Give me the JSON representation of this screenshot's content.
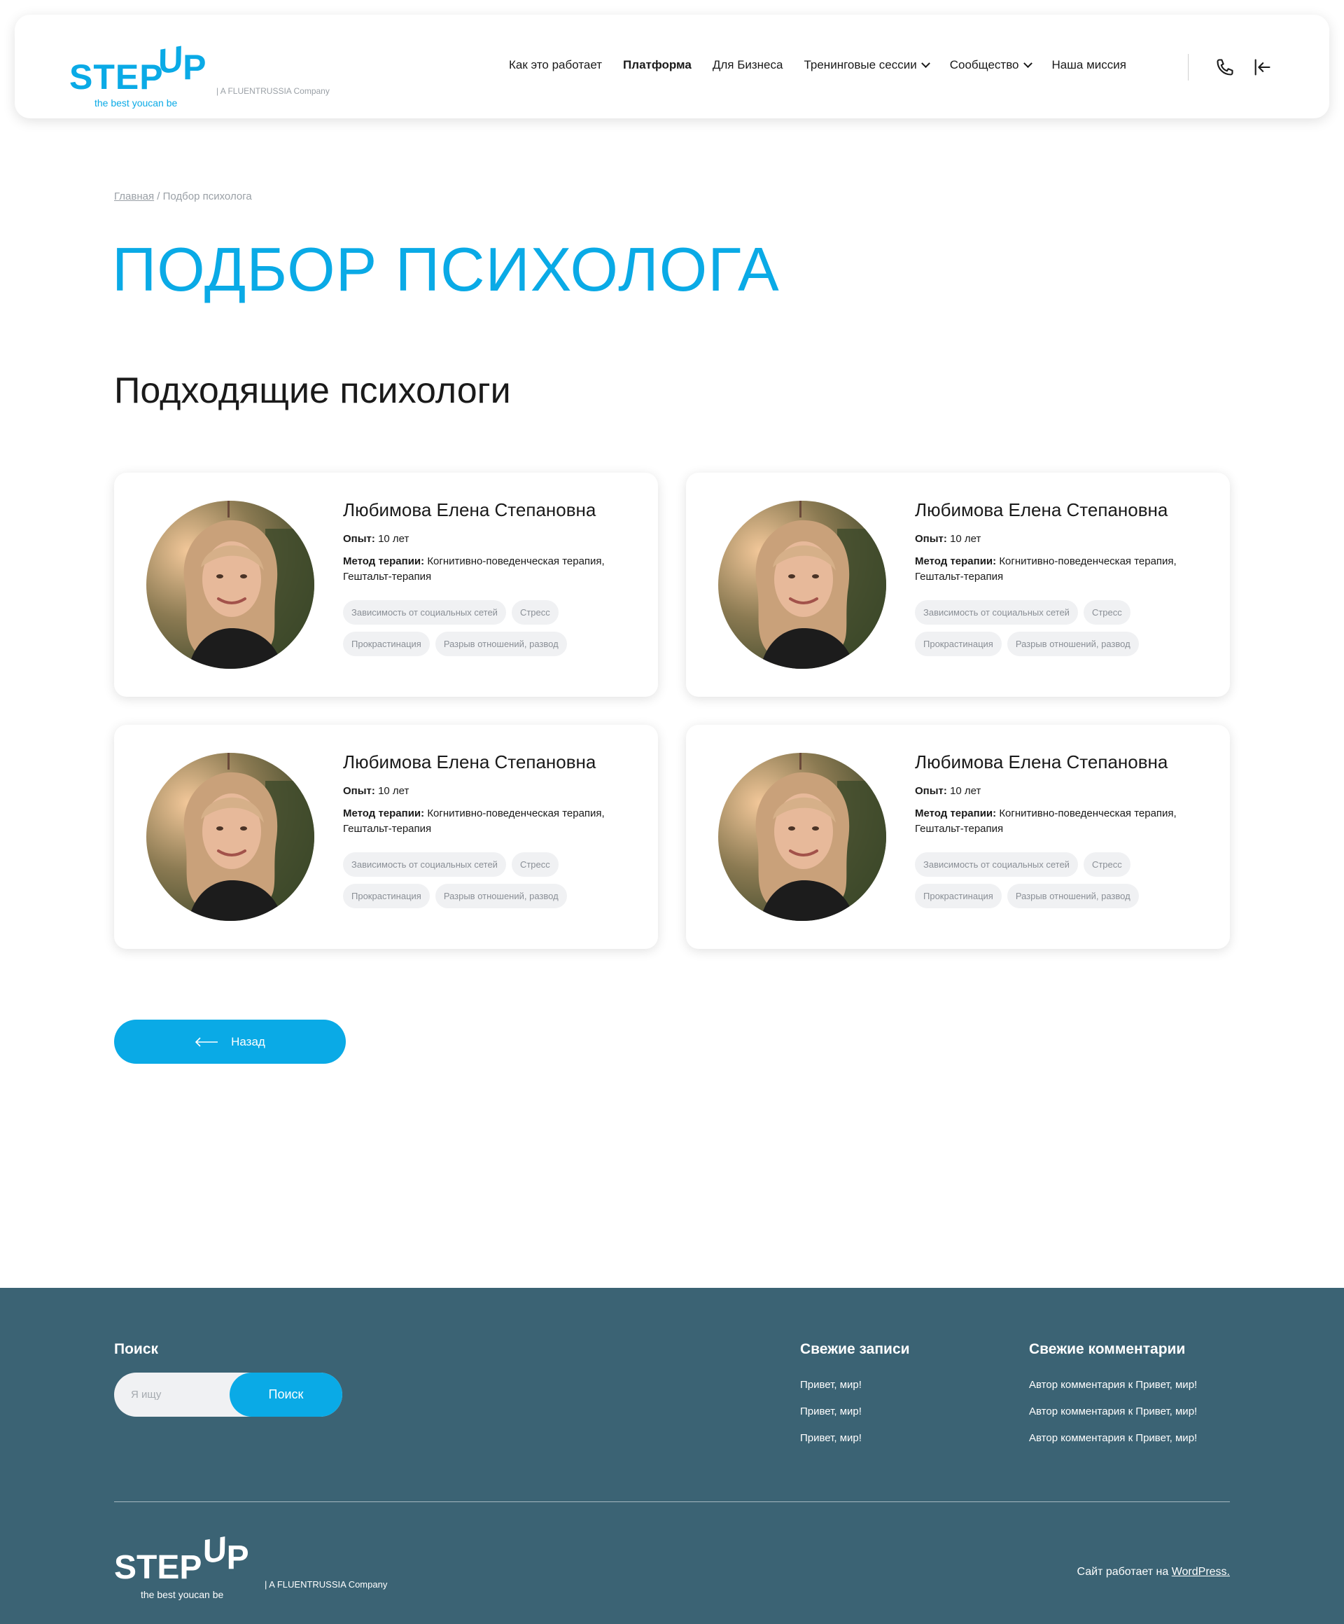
{
  "brand": {
    "step": "STEP",
    "up": "UP",
    "tagline": "the best youcan be",
    "company": "| A FLUENTRUSSIA Company",
    "accent_color": "#0aaae6",
    "footer_color": "#3b6374"
  },
  "nav": {
    "items": [
      {
        "label": "Как это работает",
        "dropdown": false
      },
      {
        "label": "Платформа",
        "dropdown": false
      },
      {
        "label": "Для Бизнеса",
        "dropdown": false
      },
      {
        "label": "Тренинговые сессии",
        "dropdown": true
      },
      {
        "label": "Сообщество",
        "dropdown": true
      },
      {
        "label": "Наша миссия",
        "dropdown": false
      }
    ],
    "icons": [
      "phone-icon",
      "login-icon"
    ]
  },
  "breadcrumb": {
    "home": "Главная",
    "separator": "/",
    "current": "Подбор психолога"
  },
  "page": {
    "title": "ПОДБОР ПСИХОЛОГА",
    "section_title": "Подходящие психологи",
    "back_label": "Назад"
  },
  "cards": [
    {
      "name": "Любимова Елена Степановна",
      "exp_label": "Опыт:",
      "exp_value": "10 лет",
      "method_label": "Метод терапии:",
      "method_value": "Когнитивно-поведенческая терапия, Гештальт-терапия",
      "tags": [
        "Зависимость от социальных сетей",
        "Стресс",
        "Прокрастинация",
        "Разрыв отношений, развод"
      ]
    },
    {
      "name": "Любимова Елена Степановна",
      "exp_label": "Опыт:",
      "exp_value": "10 лет",
      "method_label": "Метод терапии:",
      "method_value": "Когнитивно-поведенческая терапия, Гештальт-терапия",
      "tags": [
        "Зависимость от социальных сетей",
        "Стресс",
        "Прокрастинация",
        "Разрыв отношений, развод"
      ]
    },
    {
      "name": "Любимова Елена Степановна",
      "exp_label": "Опыт:",
      "exp_value": "10 лет",
      "method_label": "Метод терапии:",
      "method_value": "Когнитивно-поведенческая терапия, Гештальт-терапия",
      "tags": [
        "Зависимость от социальных сетей",
        "Стресс",
        "Прокрастинация",
        "Разрыв отношений, развод"
      ]
    },
    {
      "name": "Любимова Елена Степановна",
      "exp_label": "Опыт:",
      "exp_value": "10 лет",
      "method_label": "Метод терапии:",
      "method_value": "Когнитивно-поведенческая терапия, Гештальт-терапия",
      "tags": [
        "Зависимость от социальных сетей",
        "Стресс",
        "Прокрастинация",
        "Разрыв отношений, развод"
      ]
    }
  ],
  "footer": {
    "search_heading": "Поиск",
    "search_placeholder": "Я ищу",
    "search_button": "Поиск",
    "recent_posts_heading": "Свежие записи",
    "recent_posts": [
      "Привет, мир!",
      "Привет, мир!",
      "Привет, мир!"
    ],
    "recent_comments_heading": "Свежие комментарии",
    "recent_comments": [
      "Автор комментария к Привет, мир!",
      "Автор комментария к Привет, мир!",
      "Автор комментария к Привет, мир!"
    ],
    "powered_text": "Сайт работает на",
    "powered_link": "WordPress."
  }
}
